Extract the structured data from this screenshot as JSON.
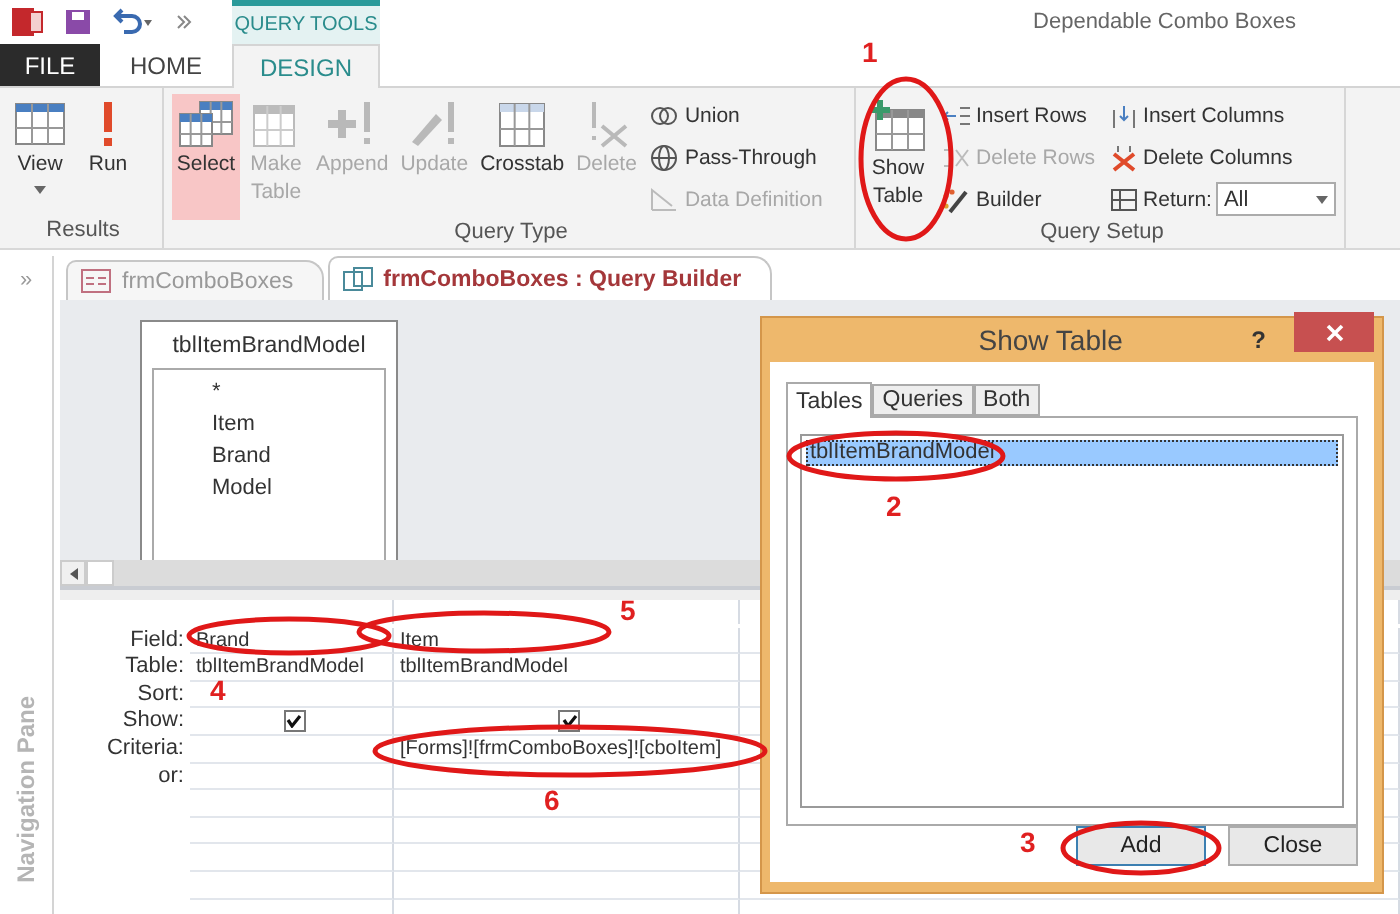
{
  "app": {
    "title": "Dependable Combo Boxes",
    "context_tab": "QUERY TOOLS"
  },
  "ribbon_tabs": [
    {
      "label": "FILE",
      "kind": "file",
      "selected": false
    },
    {
      "label": "HOME",
      "kind": "plain",
      "selected": false
    },
    {
      "label": "DESIGN",
      "kind": "plain",
      "selected": true
    }
  ],
  "ribbon_groups": [
    {
      "label": "Results",
      "large": [
        {
          "label": "View",
          "kind": "view",
          "dropdown": true,
          "disabled": false,
          "selected": false
        },
        {
          "label": "Run",
          "kind": "run",
          "disabled": false,
          "selected": false
        }
      ]
    },
    {
      "label": "Query Type",
      "large": [
        {
          "label": "Select",
          "kind": "select",
          "disabled": false,
          "selected": true
        },
        {
          "label": "Make Table",
          "kind": "make-table",
          "disabled": true,
          "selected": false
        },
        {
          "label": "Append",
          "kind": "append",
          "disabled": true,
          "selected": false
        },
        {
          "label": "Update",
          "kind": "update",
          "disabled": true,
          "selected": false
        },
        {
          "label": "Crosstab",
          "kind": "crosstab",
          "disabled": false,
          "selected": false
        },
        {
          "label": "Delete",
          "kind": "delete",
          "disabled": true,
          "selected": false
        }
      ],
      "small_columns": [
        [
          {
            "label": "Union",
            "kind": "union",
            "disabled": false
          },
          {
            "label": "Pass-Through",
            "kind": "globe",
            "disabled": false
          },
          {
            "label": "Data Definition",
            "kind": "data-definition",
            "disabled": true
          }
        ]
      ]
    },
    {
      "label": "Query Setup",
      "large": [
        {
          "label": "Show Table",
          "kind": "show-table",
          "disabled": false,
          "selected": false
        }
      ],
      "small_columns": [
        [
          {
            "label": "Insert Rows",
            "kind": "insert-rows",
            "disabled": false
          },
          {
            "label": "Delete Rows",
            "kind": "delete-rows",
            "disabled": true
          },
          {
            "label": "Builder",
            "kind": "builder",
            "disabled": false
          }
        ],
        [
          {
            "label": "Insert Columns",
            "kind": "insert-columns",
            "disabled": false
          },
          {
            "label": "Delete Columns",
            "kind": "delete-columns",
            "disabled": false
          },
          {
            "label": "Return:",
            "kind": "return",
            "disabled": false,
            "value": "All"
          }
        ]
      ]
    }
  ],
  "nav_pane": {
    "toggle": "»",
    "label": "Navigation Pane"
  },
  "doc_tabs": [
    {
      "label": "frmComboBoxes",
      "kind": "form",
      "selected": false
    },
    {
      "label": "frmComboBoxes : Query Builder",
      "kind": "query",
      "selected": true
    }
  ],
  "field_list": {
    "title": "tblItemBrandModel",
    "fields": [
      "*",
      "Item",
      "Brand",
      "Model"
    ]
  },
  "grid": {
    "row_labels": [
      "Field:",
      "Table:",
      "Sort:",
      "Show:",
      "Criteria:",
      "or:"
    ],
    "columns": [
      {
        "field": "Brand",
        "table": "tblItemBrandModel",
        "show": true
      },
      {
        "field": "Item",
        "table": "tblItemBrandModel",
        "show": true,
        "criteria": "[Forms]![frmComboBoxes]![cboItem]"
      }
    ]
  },
  "dialog": {
    "title": "Show Table",
    "help": "?",
    "tabs": [
      {
        "label": "Tables",
        "selected": true
      },
      {
        "label": "Queries",
        "selected": false
      },
      {
        "label": "Both",
        "selected": false
      }
    ],
    "items": [
      {
        "label": "tblItemBrandModel",
        "selected": true
      }
    ],
    "buttons": [
      {
        "label": "Add",
        "default": true
      },
      {
        "label": "Close",
        "default": false
      }
    ]
  },
  "annotations": [
    {
      "text": "1"
    },
    {
      "text": "2"
    },
    {
      "text": "3"
    },
    {
      "text": "4"
    },
    {
      "text": "5"
    },
    {
      "text": "6"
    }
  ]
}
